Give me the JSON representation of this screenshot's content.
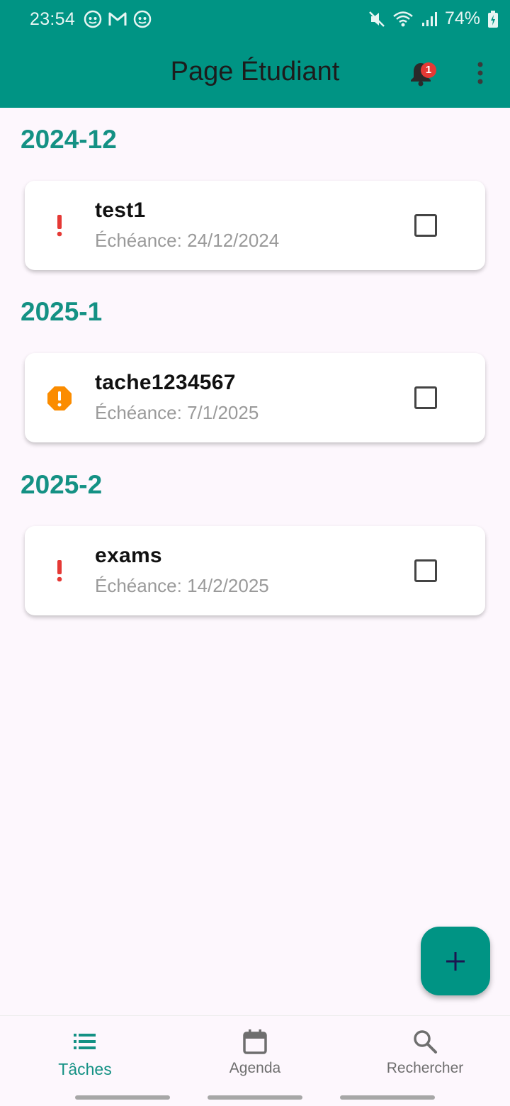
{
  "status_bar": {
    "time": "23:54",
    "left_icons": [
      "notification-app-icon",
      "gmail-icon",
      "notification-app-icon"
    ],
    "right_icons": [
      "mute-icon",
      "wifi-icon",
      "signal-icon"
    ],
    "battery_percent": "74%"
  },
  "app_bar": {
    "title": "Page Étudiant",
    "notification_count": "1"
  },
  "task_groups": [
    {
      "heading": "2024-12",
      "tasks": [
        {
          "title": "test1",
          "due": "Échéance: 24/12/2024",
          "priority": "high",
          "checked": false
        }
      ]
    },
    {
      "heading": "2025-1",
      "tasks": [
        {
          "title": "tache1234567",
          "due": "Échéance: 7/1/2025",
          "priority": "medium",
          "checked": false
        }
      ]
    },
    {
      "heading": "2025-2",
      "tasks": [
        {
          "title": "exams",
          "due": "Échéance: 14/2/2025",
          "priority": "high",
          "checked": false
        }
      ]
    }
  ],
  "bottom_nav": {
    "items": [
      {
        "label": "Tâches",
        "icon": "list-icon",
        "active": true
      },
      {
        "label": "Agenda",
        "icon": "calendar-icon",
        "active": false
      },
      {
        "label": "Rechercher",
        "icon": "search-icon",
        "active": false
      }
    ]
  },
  "colors": {
    "primary": "#009484",
    "accent_text": "#149184",
    "priority_high": "#e53935",
    "priority_medium": "#fb8c00",
    "background": "#fdf7fd"
  }
}
